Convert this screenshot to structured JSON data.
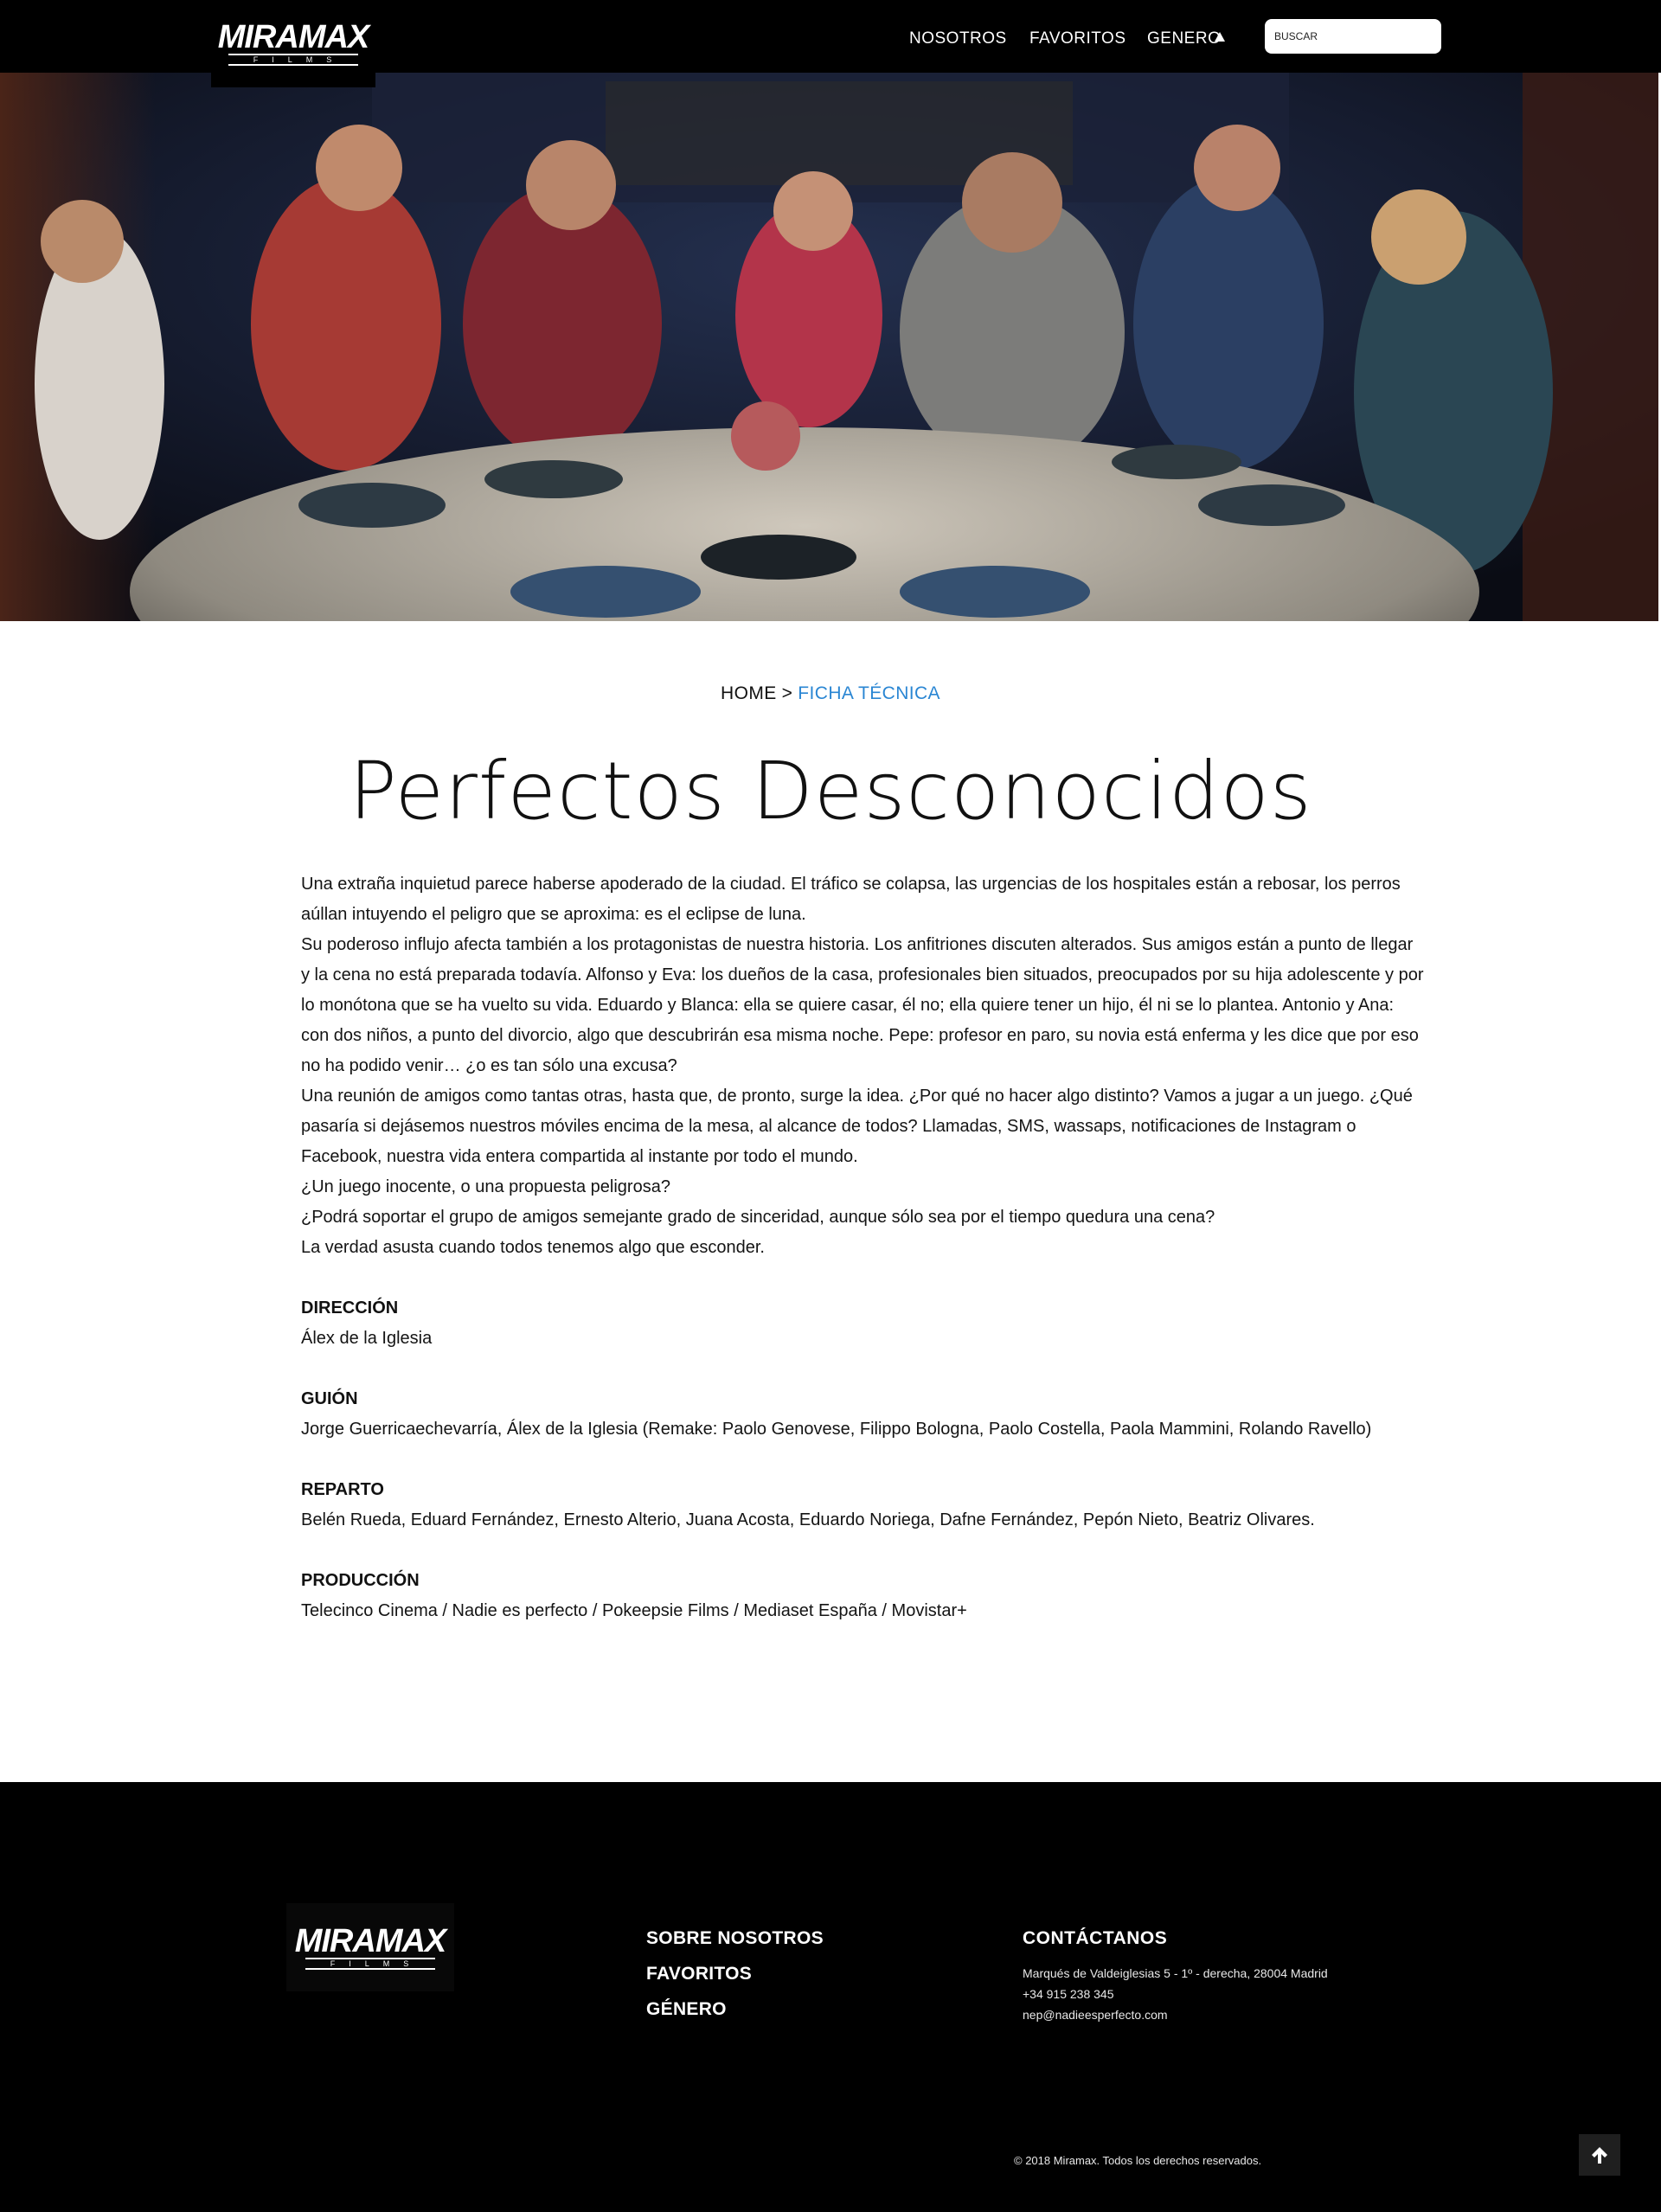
{
  "header": {
    "logo_main": "MIRAMAX",
    "logo_sub": "FILMS",
    "nav": [
      "NOSOTROS",
      "FAVORITOS",
      "GENERO"
    ],
    "search_placeholder": "BUSCAR"
  },
  "breadcrumb": {
    "home": "HOME",
    "separator": ">",
    "current": "FICHA TÉCNICA"
  },
  "title": "Perfectos Desconocidos",
  "synopsis": [
    "Una extraña inquietud parece haberse apoderado de la ciudad. El tráfico se colapsa, las urgencias de los hospitales están a rebosar, los perros aúllan intuyendo el peligro que se aproxima: es el eclipse de luna.",
    "Su poderoso influjo afecta también a los protagonistas de nuestra historia. Los anfitriones discuten alterados. Sus amigos están a punto de llegar y la cena no está preparada todavía. Alfonso y Eva: los dueños de la casa, profesionales bien situados, preocupados por su hija adolescente y por lo monótona que se ha vuelto su vida. Eduardo y Blanca: ella se quiere casar, él no; ella quiere tener un hijo, él ni se lo plantea. Antonio y Ana: con dos niños, a punto del divorcio, algo que descubrirán esa misma noche. Pepe: profesor en paro, su novia está enferma y les dice que por eso no ha podido venir… ¿o es tan sólo una excusa?",
    "Una reunión de amigos como tantas otras, hasta que, de pronto, surge la idea. ¿Por qué no hacer algo distinto? Vamos a jugar a un juego. ¿Qué pasaría si dejásemos nuestros móviles encima de la mesa, al alcance de todos? Llamadas, SMS, wassaps, notificaciones de Instagram o Facebook, nuestra vida entera compartida al instante por todo el mundo.",
    "¿Un juego inocente, o una propuesta peligrosa?",
    "¿Podrá soportar el grupo de amigos semejante grado de sinceridad, aunque sólo sea por el tiempo quedura una cena?",
    "La verdad asusta cuando todos tenemos algo que esconder."
  ],
  "credits": {
    "direccion": {
      "label": "DIRECCIÓN",
      "value": "Álex de la Iglesia"
    },
    "guion": {
      "label": "GUIÓN",
      "value": "Jorge Guerricaechevarría, Álex de la Iglesia (Remake: Paolo Genovese, Filippo Bologna, Paolo Costella, Paola Mammini, Rolando Ravello)"
    },
    "reparto": {
      "label": "REPARTO",
      "value": "Belén Rueda, Eduard Fernández, Ernesto Alterio, Juana Acosta, Eduardo Noriega, Dafne Fernández, Pepón Nieto, Beatriz Olivares."
    },
    "produccion": {
      "label": "PRODUCCIÓN",
      "value": "Telecinco Cinema / Nadie es perfecto / Pokeepsie Films / Mediaset España / Movistar+"
    }
  },
  "footer": {
    "links": [
      "SOBRE NOSOTROS",
      "FAVORITOS",
      "GÉNERO"
    ],
    "contact_title": "CONTÁCTANOS",
    "address": "Marqués de Valdeiglesias 5 - 1º - derecha, 28004 Madrid",
    "phone": "+34 915 238 345",
    "email": "nep@nadieesperfecto.com",
    "copyright": "© 2018 Miramax. Todos los derechos reservados."
  },
  "icons": {
    "genre_caret": "triangle-up-icon",
    "back_to_top": "arrow-up-icon"
  },
  "colors": {
    "accent": "#2a86d3",
    "header_bg": "#000000",
    "footer_bg": "#000000"
  }
}
